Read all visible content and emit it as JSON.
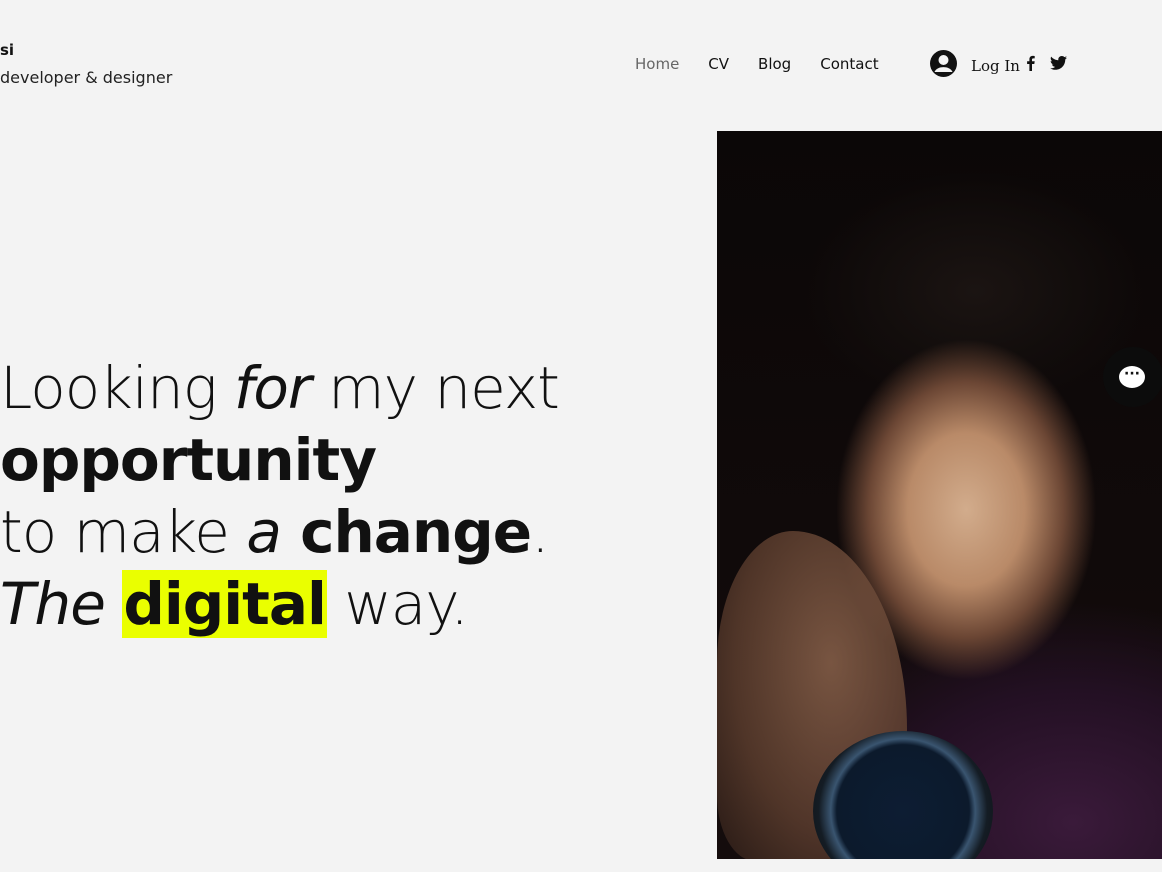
{
  "header": {
    "site_name": "si",
    "tagline": "developer & designer"
  },
  "nav": {
    "items": [
      {
        "label": "Home",
        "active": true
      },
      {
        "label": "CV"
      },
      {
        "label": "Blog"
      },
      {
        "label": "Contact"
      }
    ],
    "login_label": "Log In",
    "social": [
      "facebook-icon",
      "twitter-icon"
    ]
  },
  "hero": {
    "l1_a": "Looking ",
    "l1_b": "for",
    "l1_c": " my next",
    "l2": "opportunity",
    "l3_a": "to make ",
    "l3_b": "a",
    "l3_c": " change",
    "l3_d": ".",
    "l4_a": "The",
    "l4_b": "digital",
    "l4_c": " way."
  },
  "chat": {
    "icon": "chat-icon",
    "glyph": "···"
  },
  "colors": {
    "highlight": "#eaff00",
    "background": "#f3f3f3"
  }
}
